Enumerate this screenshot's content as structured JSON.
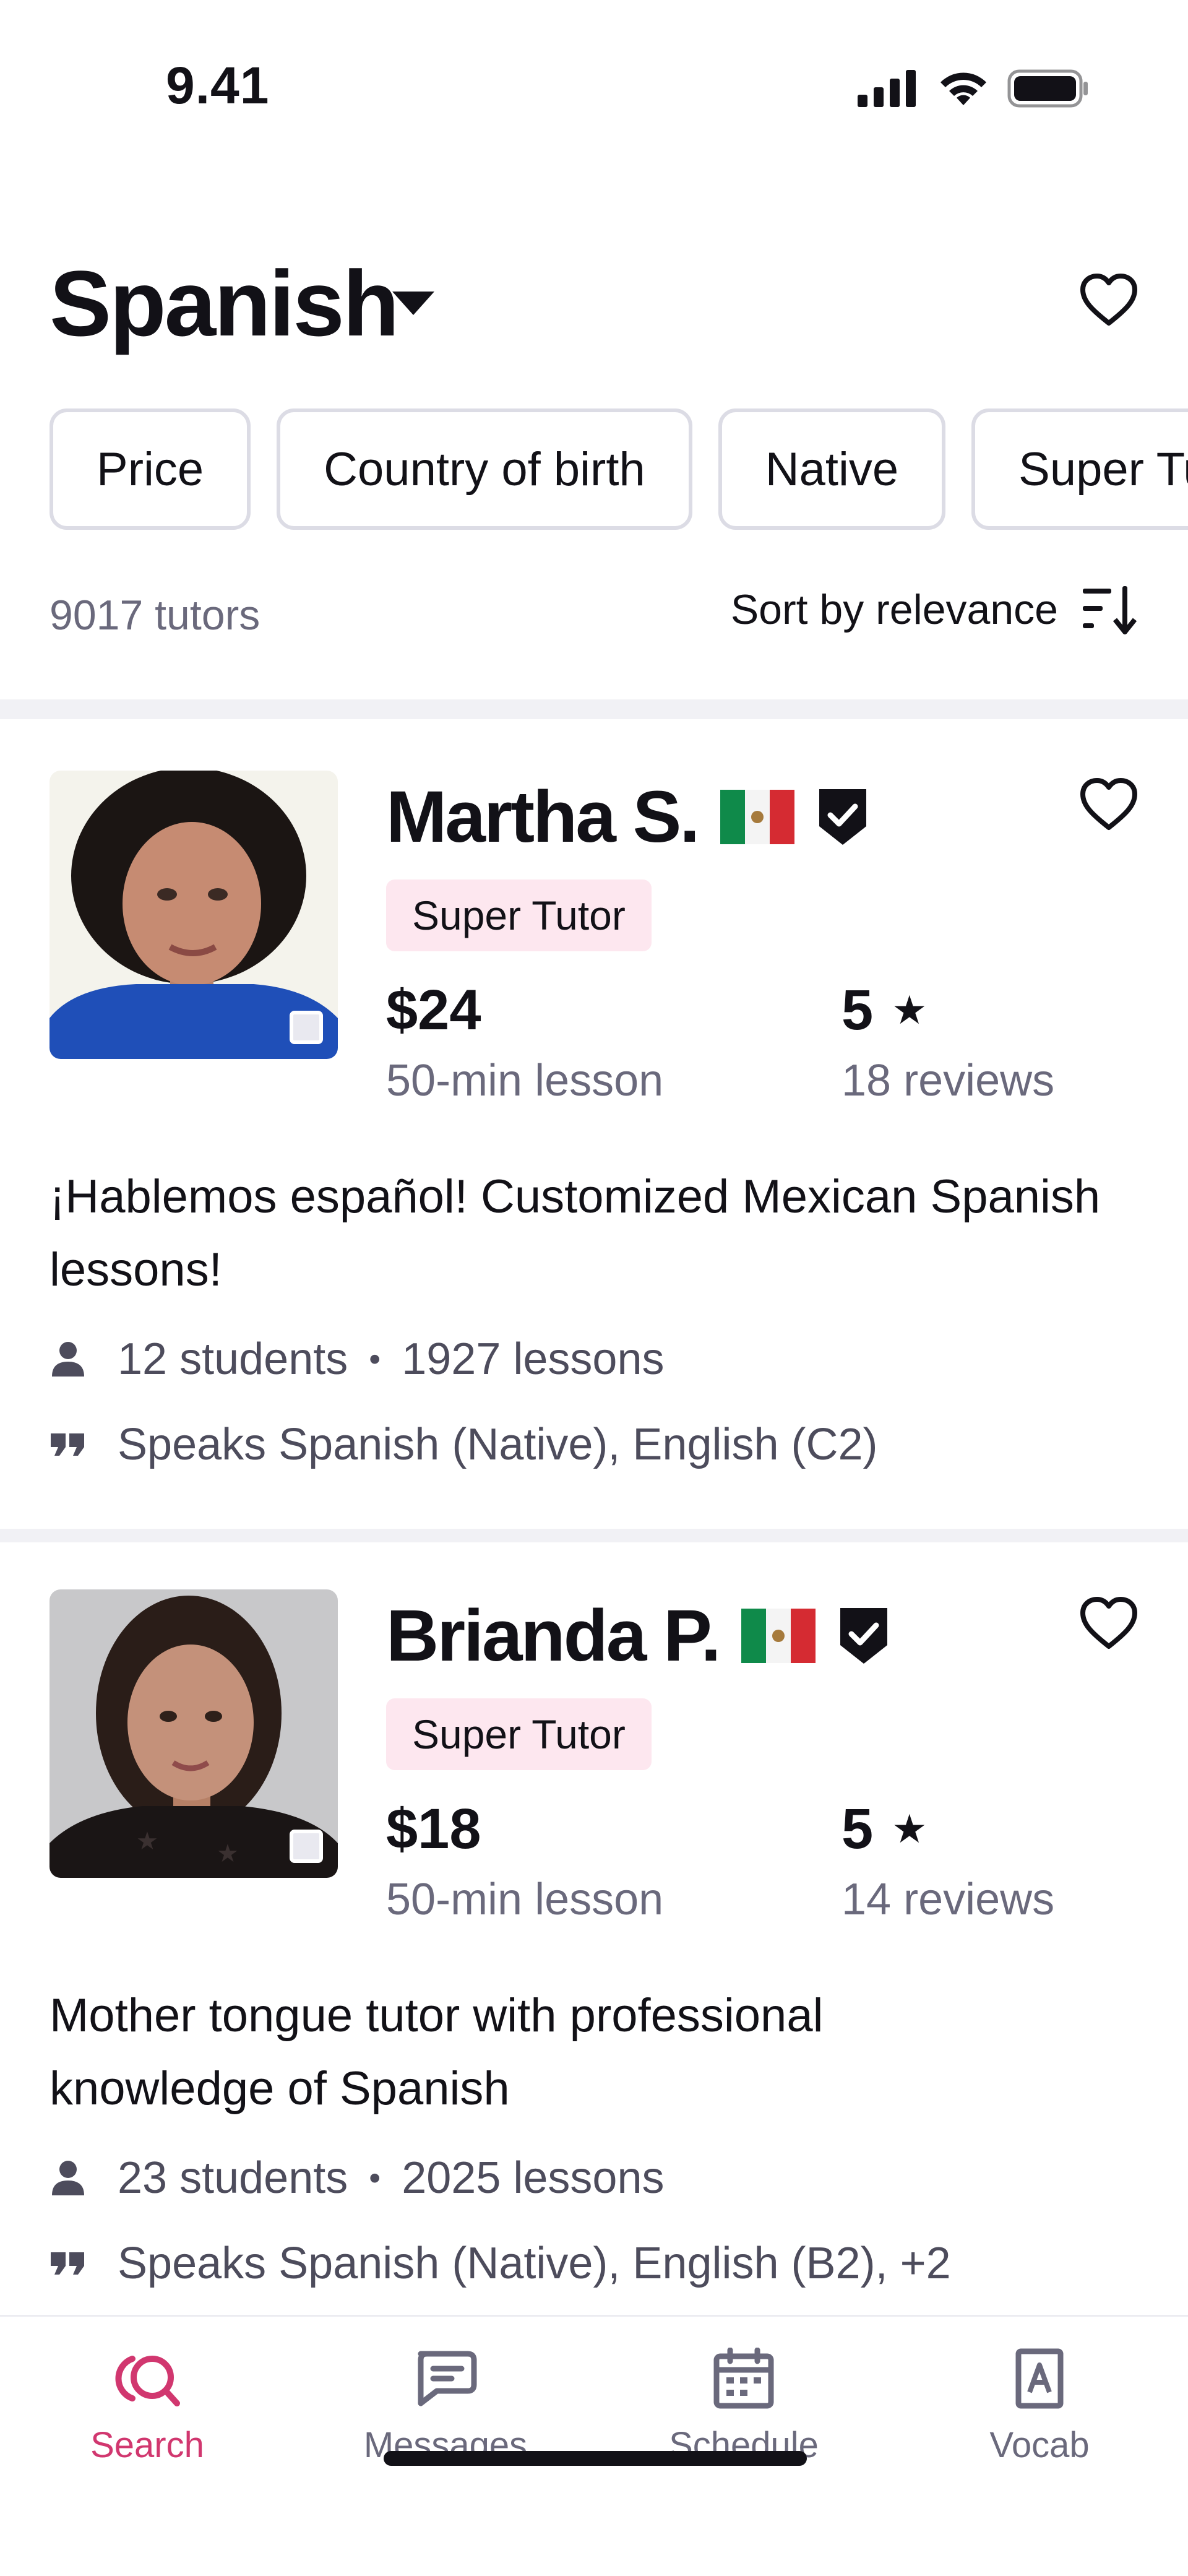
{
  "status_bar": {
    "time": "9.41"
  },
  "header": {
    "language": "Spanish"
  },
  "filters": [
    "Price",
    "Country of birth",
    "Native",
    "Super Tutor"
  ],
  "results": {
    "count_text": "9017 tutors",
    "sort_label": "Sort by relevance"
  },
  "tutors": [
    {
      "name": "Martha S.",
      "badge": "Super Tutor",
      "price": "$24",
      "price_sub": "50-min lesson",
      "rating": "5",
      "reviews": "18 reviews",
      "headline": "¡Hablemos español! Customized Mexican Spanish lessons!",
      "students": "12 students",
      "lessons": "1927 lessons",
      "speaks": "Speaks Spanish (Native), English (C2)"
    },
    {
      "name": "Brianda P.",
      "badge": "Super Tutor",
      "price": "$18",
      "price_sub": "50-min lesson",
      "rating": "5",
      "reviews": "14 reviews",
      "headline": "Mother tongue tutor with professional knowledge of Spanish",
      "students": "23 students",
      "lessons": "2025 lessons",
      "speaks": "Speaks Spanish (Native), English (B2), +2"
    }
  ],
  "tabs": [
    {
      "label": "Search",
      "icon": "search-icon",
      "active": true
    },
    {
      "label": "Messages",
      "icon": "messages-icon",
      "active": false
    },
    {
      "label": "Schedule",
      "icon": "calendar-icon",
      "active": false
    },
    {
      "label": "Vocab",
      "icon": "vocab-icon",
      "active": false
    }
  ],
  "colors": {
    "accent": "#d1376f",
    "badge_bg": "#fde7ef",
    "muted_text": "#6a697c"
  }
}
